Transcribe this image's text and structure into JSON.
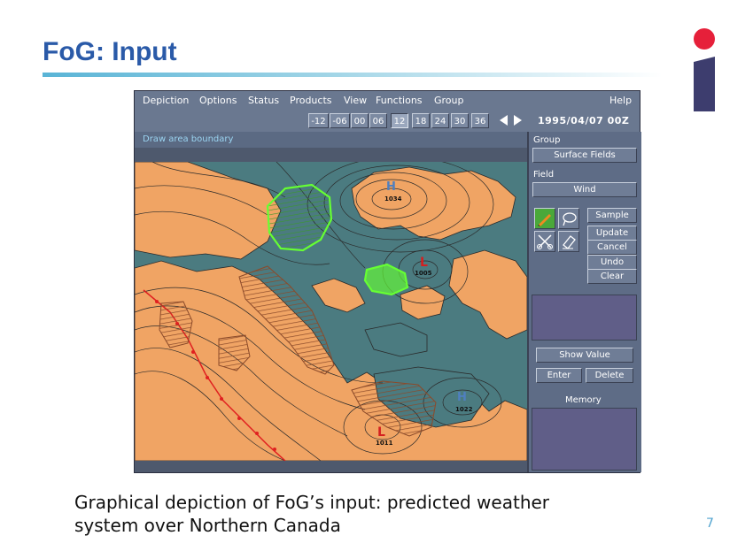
{
  "slide": {
    "title": "FoG: Input",
    "caption_line1": "Graphical depiction of FoG’s input:  predicted weather",
    "caption_line2": "system over Northern Canada",
    "page_number": "7",
    "logo": "i-logo"
  },
  "app": {
    "menu": [
      "Depiction",
      "Options",
      "Status",
      "Products",
      "View",
      "Functions",
      "Group"
    ],
    "help": "Help",
    "hours": [
      "-12",
      "-06",
      "00",
      "06",
      "12",
      "18",
      "24",
      "30",
      "36"
    ],
    "selected_hour": "12",
    "datetime": "1995/04/07  00Z",
    "status_text": "Draw area boundary",
    "panel": {
      "group_label": "Group",
      "group_value": "Surface Fields",
      "field_label": "Field",
      "field_value": "Wind",
      "actions": [
        "Sample",
        "Update",
        "Cancel",
        "Undo",
        "Clear"
      ],
      "show_value": "Show Value",
      "enter": "Enter",
      "delete": "Delete",
      "memory": "Memory"
    },
    "map": {
      "pressure_centers": [
        {
          "type": "H",
          "value": "1034"
        },
        {
          "type": "L",
          "value": "1005"
        },
        {
          "type": "H",
          "value": "1022"
        },
        {
          "type": "L",
          "value": "1011"
        }
      ],
      "colors": {
        "water": "#4b7b80",
        "land": "#f0a464",
        "green_area": "#66ff33",
        "hatch": "#8b4a2a",
        "front": "#e02020"
      }
    }
  }
}
